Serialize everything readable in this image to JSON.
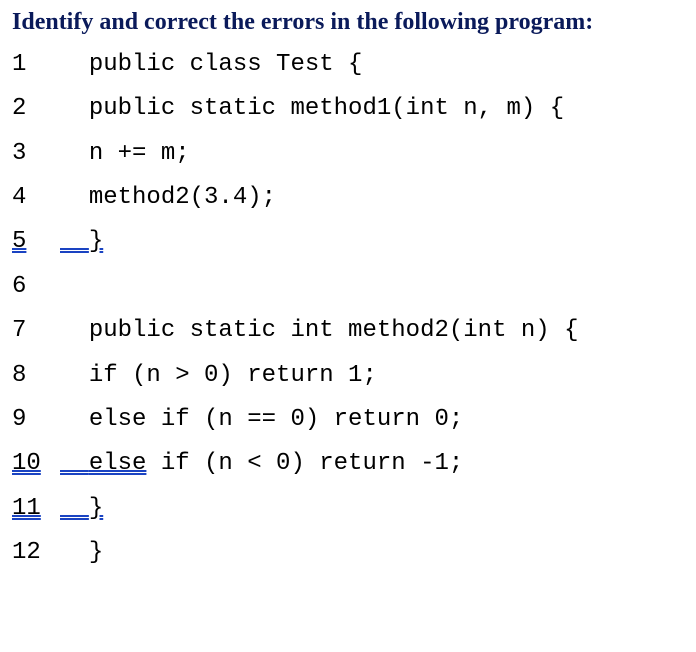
{
  "heading": "Identify and correct the errors in the following program:",
  "code": {
    "lines": [
      {
        "num": "1",
        "pre": "  ",
        "code": "public class Test {",
        "err_num": false,
        "err_code": false
      },
      {
        "num": "2",
        "pre": "  ",
        "code": "public static method1(int n, m) {",
        "err_num": false,
        "err_code": false
      },
      {
        "num": "3",
        "pre": "  ",
        "code": "n += m;",
        "err_num": false,
        "err_code": false
      },
      {
        "num": "4",
        "pre": "  ",
        "code": "method2(3.4);",
        "err_num": false,
        "err_code": false
      },
      {
        "num": "5",
        "pre": "  ",
        "code": "}",
        "err_num": true,
        "err_code": true
      },
      {
        "num": "6",
        "pre": "",
        "code": "",
        "err_num": false,
        "err_code": false
      },
      {
        "num": "7",
        "pre": "  ",
        "code": "public static int method2(int n) {",
        "err_num": false,
        "err_code": false
      },
      {
        "num": "8",
        "pre": "  ",
        "code": "if (n > 0) return 1;",
        "err_num": false,
        "err_code": false
      },
      {
        "num": "9",
        "pre": "  ",
        "code": "else if (n == 0) return 0;",
        "err_num": false,
        "err_code": false
      },
      {
        "num": "10",
        "pre": "  ",
        "code_pre": "else",
        "code_post": " if (n < 0) return -1;",
        "split": true,
        "err_num": true,
        "err_code_pre": true
      },
      {
        "num": "11",
        "pre": "  ",
        "code": "}",
        "err_num": true,
        "err_code": true
      },
      {
        "num": "12",
        "pre": "  ",
        "code": "}",
        "err_num": false,
        "err_code": false
      }
    ]
  }
}
